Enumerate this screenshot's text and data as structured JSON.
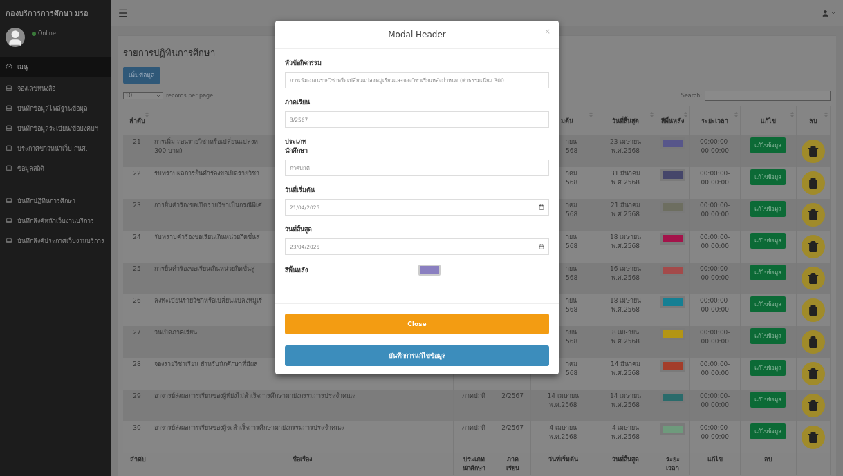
{
  "sidebar": {
    "title": "กองบริการการศึกษา มรอ",
    "status": "Online",
    "sections": [
      [
        {
          "label": "เมนู",
          "selected": true
        },
        {
          "label": "จองเลขหนังสือ",
          "selected": false
        },
        {
          "label": "บันทึกข้อมูลไฟล์ฐานข้อมูล",
          "selected": false
        },
        {
          "label": "บันทึกข้อมูลระเบียน/ข้อบังคับฯ",
          "selected": false
        },
        {
          "label": "ประกาศข่าวหน้าเว็บ กนศ.",
          "selected": false
        },
        {
          "label": "ข้อมูลสถิติ",
          "selected": false
        }
      ],
      [
        {
          "label": "บันทึกปฏิทินการศึกษา",
          "selected": false
        },
        {
          "label": "บันทึกลิงค์หน้าเว็บงานบริการ",
          "selected": false
        },
        {
          "label": "บันทึกลิงค์ประกาศเว็บงานบริการ",
          "selected": false
        }
      ]
    ]
  },
  "page": {
    "title": "รายการปฏิทินการศึกษา",
    "add_button": "เพิ่มข้อมูล",
    "page_size": "10",
    "page_size_label": "records per page",
    "search_label": "Search:"
  },
  "table": {
    "header": [
      {
        "label": "ลำดับ",
        "kind": "number"
      },
      {
        "label": "มต้น",
        "kind": "start"
      },
      {
        "label": "วันที่สิ้นสุด",
        "kind": "end"
      },
      {
        "label": "สีพื้นหลัง",
        "kind": "color"
      },
      {
        "label": "ระยะเวลา",
        "kind": "duration"
      },
      {
        "label": "แก้ไข",
        "kind": "edit"
      },
      {
        "label": "ลบ",
        "kind": "delete"
      }
    ],
    "rows": [
      {
        "no": "21",
        "title_lines": [
          "การเพิ่ม-ถอนรายวิชาหรือเปลี่ยนแปลงห",
          "300 บาท)"
        ],
        "start_lines": [
          "ายน",
          "568"
        ],
        "end_date": "23 เมษายน พ.ศ.2568",
        "color": "#57568a",
        "duration": "00:00:00-00:00:00",
        "edit": "แก้ไขข้อมูล"
      },
      {
        "no": "22",
        "title_lines": [
          "รับทราบผลการยื่นคำร้องขอเปิดรายวิชา"
        ],
        "start_lines": [
          "าคม",
          "568"
        ],
        "end_date": "31 มีนาคม พ.ศ.2568",
        "color": "#45466a",
        "duration": "00:00:00-00:00:00",
        "edit": "แก้ไขข้อมูล"
      },
      {
        "no": "23",
        "title_lines": [
          "การยื่นคำร้องขอเปิดรายวิชาเป็นกรณีพิเศ"
        ],
        "start_lines": [
          "าคม",
          "568"
        ],
        "end_date": "21 มีนาคม พ.ศ.2568",
        "color": "#6d6e60",
        "duration": "00:00:00-00:00:00",
        "edit": "แก้ไขข้อมูล"
      },
      {
        "no": "24",
        "title_lines": [
          "รับทราบคำร้องขอเรียนเกินหน่วยกิตขั้นส"
        ],
        "start_lines": [
          "ายน",
          "568"
        ],
        "end_date": "18 เมษายน พ.ศ.2568",
        "color": "#a3134a",
        "duration": "00:00:00-00:00:00",
        "edit": "แก้ไขข้อมูล"
      },
      {
        "no": "25",
        "title_lines": [
          "การยื่นคำร้องขอเรียนเกินหน่วยกิตขั้นสู"
        ],
        "start_lines": [
          "ายน",
          "568"
        ],
        "end_date": "16 เมษายน พ.ศ.2568",
        "color": "#a34a4a",
        "duration": "00:00:00-00:00:00",
        "edit": "แก้ไขข้อมูล"
      },
      {
        "no": "26",
        "title_lines": [
          "ลงทะเบียนรายวิชาหรือเปลี่ยนแปลงหมู่เรี"
        ],
        "start_lines": [
          "ายน",
          "568"
        ],
        "end_date": "18 เมษายน พ.ศ.2568",
        "color": "#157f93",
        "duration": "00:00:00-00:00:00",
        "edit": "แก้ไขข้อมูล"
      },
      {
        "no": "27",
        "title_lines": [
          "วันเปิดภาคเรียน"
        ],
        "start_lines": [
          "ายน",
          "568"
        ],
        "end_date": "8 เมษายน พ.ศ.2568",
        "color": "#b39514",
        "duration": "00:00:00-00:00:00",
        "edit": "แก้ไขข้อมูล"
      },
      {
        "no": "28",
        "title_lines": [
          "จองรายวิชาเรียน สำหรับนักศึกษาที่มีผล"
        ],
        "start_lines": [
          "าคม",
          "568"
        ],
        "end_date": "14 มีนาคม พ.ศ.2568",
        "color": "#a33d2a",
        "duration": "00:00:00-00:00:00",
        "edit": "แก้ไขข้อมูล"
      },
      {
        "no": "29",
        "title_lines": [
          "อาจารย์ส่งผลการเรียนของผู้ที่ยังไม่สำเร็จการศึกษามายังกรรมการประจำคณะ"
        ],
        "type": "ภาคปกติ",
        "semester": "2/2567",
        "start_lines": [
          "14 เมษายน",
          "พ.ศ.2568"
        ],
        "end_date": "14 เมษายน พ.ศ.2568",
        "color": "#2a6b6b",
        "duration": "00:00:00-00:00:00",
        "edit": "แก้ไขข้อมูล"
      },
      {
        "no": "30",
        "title_lines": [
          "อาจารย์ส่งผลการเรียนของผู้จะสำเร็จการศึกษามายังกรรมการประจำคณะ"
        ],
        "type": "ภาคปกติ",
        "semester": "2/2567",
        "start_lines": [
          "4 เมษายน",
          "พ.ศ.2568"
        ],
        "end_date": "4 เมษายน พ.ศ.2568",
        "color": "#6e9a7c",
        "duration": "00:00:00-00:00:00",
        "edit": "แก้ไขข้อมูล"
      }
    ],
    "footer": [
      "ลำดับ",
      "ชื่อเรื่อง",
      "ประเภท นักศึกษา",
      "ภาค เรียน",
      "วันที่เริ่มต้น",
      "วันที่สิ้นสุด",
      "ระยะ เวลา",
      "แก้ไข",
      "ลบ"
    ]
  },
  "modal": {
    "title": "Modal Header",
    "close_icon": "×",
    "fields": [
      {
        "kind": "text",
        "label": "หัวข้อกิจกรรม",
        "value": "การเพิ่ม-ถอนรายวิชาหรือเปลี่ยนแปลงหมู่เรียนและจองวิชาเรียนหลังกำหนด (ค่าธรรมเนียม 300"
      },
      {
        "kind": "text",
        "label": "ภาคเรียน",
        "value": "3/2567"
      },
      {
        "kind": "text",
        "label": "ประเภท นักศึกษา",
        "value": "ภาคปกติ"
      },
      {
        "kind": "date",
        "label": "วันที่เริ่มต้น",
        "value": "21/04/2025"
      },
      {
        "kind": "date",
        "label": "วันที่สิ้นสุด",
        "value": "23/04/2025"
      },
      {
        "kind": "color",
        "label": "สีพื้นหลัง",
        "color": "#8a7fc0"
      }
    ],
    "buttons": [
      {
        "kind": "close",
        "label": "Close"
      },
      {
        "kind": "save",
        "label": "บันทึกการแก้ไขข้อมูล"
      }
    ]
  }
}
